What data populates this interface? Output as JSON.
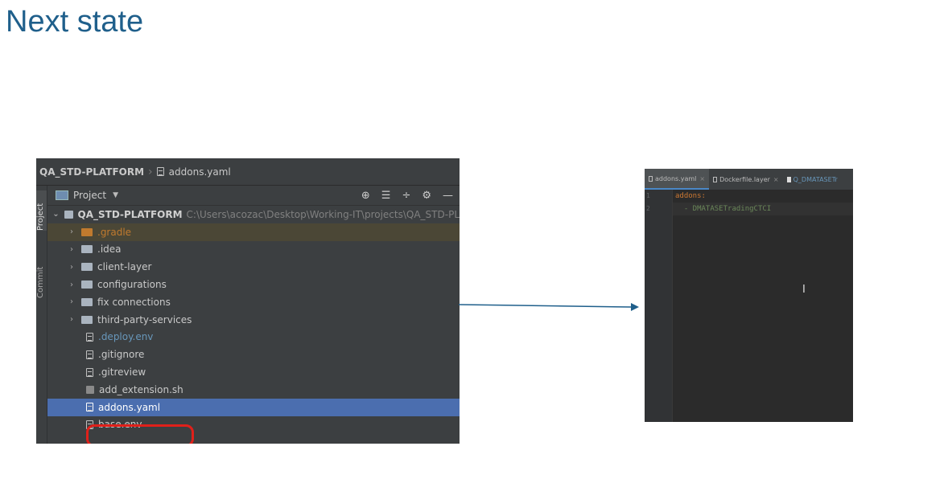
{
  "slide": {
    "title": "Next state"
  },
  "ide": {
    "breadcrumb": {
      "root": "QA_STD-PLATFORM",
      "file": "addons.yaml"
    },
    "side_tabs": {
      "project": "Project",
      "commit": "Commit"
    },
    "tool_window": {
      "title": "Project",
      "actions": [
        "⊕",
        "☰",
        "÷",
        "⚙",
        "—"
      ]
    },
    "tree": {
      "root": {
        "name": "QA_STD-PLATFORM",
        "path": "C:\\Users\\acozac\\Desktop\\Working-IT\\projects\\QA_STD-PL"
      },
      "folders": [
        ".gradle",
        ".idea",
        "client-layer",
        "configurations",
        "fix connections",
        "third-party-services"
      ],
      "files": [
        ".deploy.env",
        ".gitignore",
        ".gitreview",
        "add_extension.sh",
        "addons.yaml",
        "base.env"
      ],
      "selected": "addons.yaml"
    }
  },
  "editor": {
    "tabs": [
      {
        "label": "addons.yaml"
      },
      {
        "label": "Dockerfile.layer"
      },
      {
        "label": "Q_DMATASETr"
      }
    ],
    "line_numbers": [
      "1",
      "2"
    ],
    "code": {
      "key": "addons:",
      "item": "  - DMATASETradingCTCI"
    }
  },
  "colors": {
    "accent": "#4b6eaf",
    "title": "#1f5f8b",
    "highlight": "#e0201a",
    "arrow": "#1f5f8b"
  }
}
